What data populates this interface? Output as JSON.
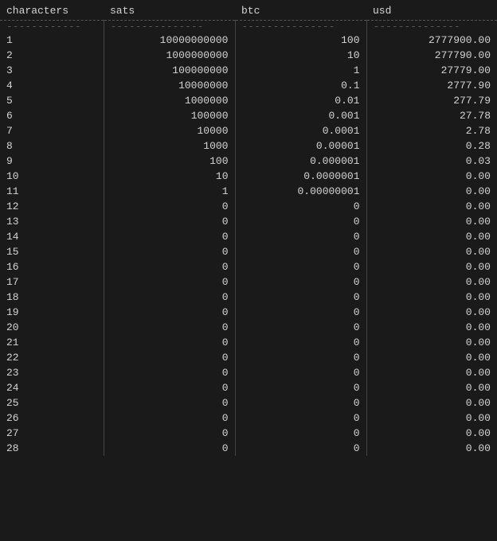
{
  "table": {
    "columns": [
      {
        "key": "characters",
        "label": "characters"
      },
      {
        "key": "sats",
        "label": "sats"
      },
      {
        "key": "btc",
        "label": "btc"
      },
      {
        "key": "usd",
        "label": "usd"
      }
    ],
    "divider": "------------",
    "rows": [
      {
        "characters": "1",
        "sats": "10000000000",
        "btc": "100",
        "usd": "2777900.00"
      },
      {
        "characters": "2",
        "sats": "1000000000",
        "btc": "10",
        "usd": "277790.00"
      },
      {
        "characters": "3",
        "sats": "100000000",
        "btc": "1",
        "usd": "27779.00"
      },
      {
        "characters": "4",
        "sats": "10000000",
        "btc": "0.1",
        "usd": "2777.90"
      },
      {
        "characters": "5",
        "sats": "1000000",
        "btc": "0.01",
        "usd": "277.79"
      },
      {
        "characters": "6",
        "sats": "100000",
        "btc": "0.001",
        "usd": "27.78"
      },
      {
        "characters": "7",
        "sats": "10000",
        "btc": "0.0001",
        "usd": "2.78"
      },
      {
        "characters": "8",
        "sats": "1000",
        "btc": "0.00001",
        "usd": "0.28"
      },
      {
        "characters": "9",
        "sats": "100",
        "btc": "0.000001",
        "usd": "0.03"
      },
      {
        "characters": "10",
        "sats": "10",
        "btc": "0.0000001",
        "usd": "0.00"
      },
      {
        "characters": "11",
        "sats": "1",
        "btc": "0.00000001",
        "usd": "0.00"
      },
      {
        "characters": "12",
        "sats": "0",
        "btc": "0",
        "usd": "0.00"
      },
      {
        "characters": "13",
        "sats": "0",
        "btc": "0",
        "usd": "0.00"
      },
      {
        "characters": "14",
        "sats": "0",
        "btc": "0",
        "usd": "0.00"
      },
      {
        "characters": "15",
        "sats": "0",
        "btc": "0",
        "usd": "0.00"
      },
      {
        "characters": "16",
        "sats": "0",
        "btc": "0",
        "usd": "0.00"
      },
      {
        "characters": "17",
        "sats": "0",
        "btc": "0",
        "usd": "0.00"
      },
      {
        "characters": "18",
        "sats": "0",
        "btc": "0",
        "usd": "0.00"
      },
      {
        "characters": "19",
        "sats": "0",
        "btc": "0",
        "usd": "0.00"
      },
      {
        "characters": "20",
        "sats": "0",
        "btc": "0",
        "usd": "0.00"
      },
      {
        "characters": "21",
        "sats": "0",
        "btc": "0",
        "usd": "0.00"
      },
      {
        "characters": "22",
        "sats": "0",
        "btc": "0",
        "usd": "0.00"
      },
      {
        "characters": "23",
        "sats": "0",
        "btc": "0",
        "usd": "0.00"
      },
      {
        "characters": "24",
        "sats": "0",
        "btc": "0",
        "usd": "0.00"
      },
      {
        "characters": "25",
        "sats": "0",
        "btc": "0",
        "usd": "0.00"
      },
      {
        "characters": "26",
        "sats": "0",
        "btc": "0",
        "usd": "0.00"
      },
      {
        "characters": "27",
        "sats": "0",
        "btc": "0",
        "usd": "0.00"
      },
      {
        "characters": "28",
        "sats": "0",
        "btc": "0",
        "usd": "0.00"
      }
    ]
  }
}
